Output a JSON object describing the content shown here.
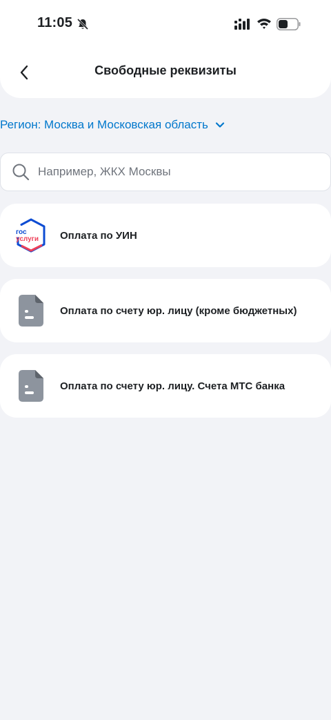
{
  "status_bar": {
    "time": "11:05"
  },
  "header": {
    "title": "Свободные реквизиты"
  },
  "region": {
    "label": "Регион: Москва и Московская область"
  },
  "search": {
    "placeholder": "Например, ЖКХ Москвы",
    "value": ""
  },
  "items": [
    {
      "label": "Оплата по УИН",
      "icon": "gosuslugi-logo-icon"
    },
    {
      "label": "Оплата по счету юр. лицу (кроме бюджетных)",
      "icon": "document-icon"
    },
    {
      "label": "Оплата по счету юр. лицу. Счета МТС банка",
      "icon": "document-icon"
    }
  ],
  "logo_text": {
    "line1": "гос",
    "line2": "услуги"
  },
  "colors": {
    "accent": "#0077cc",
    "background": "#f2f3f7",
    "card": "#ffffff",
    "document_icon": "#8d949e",
    "gosuslugi_blue": "#0d4cd3",
    "gosuslugi_red": "#ee3f58"
  }
}
